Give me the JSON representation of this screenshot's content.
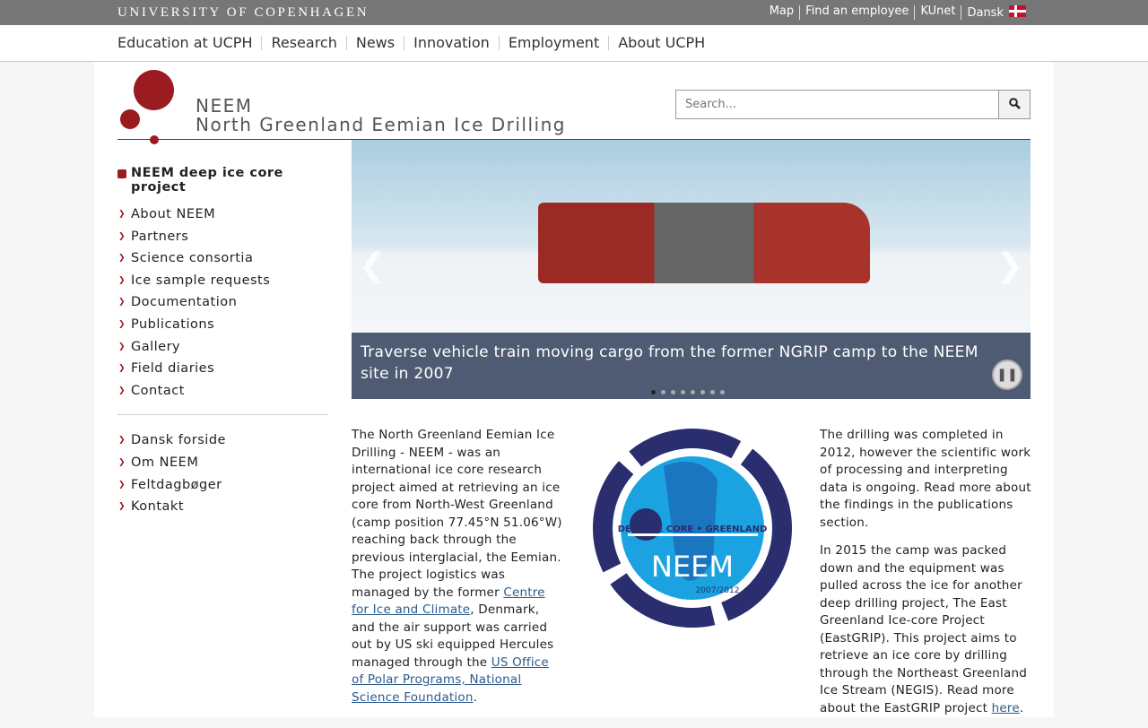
{
  "topbar": {
    "university": "UNIVERSITY OF COPENHAGEN",
    "links": [
      "Map",
      "Find an employee",
      "KUnet",
      "Dansk"
    ]
  },
  "nav": [
    "Education at UCPH",
    "Research",
    "News",
    "Innovation",
    "Employment",
    "About UCPH"
  ],
  "header": {
    "short": "NEEM",
    "title": "North Greenland Eemian Ice Drilling",
    "search_placeholder": "Search..."
  },
  "sidebar": {
    "heading": "NEEM deep ice core project",
    "items": [
      "About NEEM",
      "Partners",
      "Science consortia",
      "Ice sample requests",
      "Documentation",
      "Publications",
      "Gallery",
      "Field diaries",
      "Contact"
    ],
    "danish": [
      "Dansk forside",
      "Om NEEM",
      "Feltdagbøger",
      "Kontakt"
    ]
  },
  "slider": {
    "caption": "Traverse vehicle train moving cargo from the former NGRIP camp to the NEEM site in 2007",
    "slides": 8,
    "active": 1
  },
  "logo": {
    "text": "DEEP ICE CORE • GREENLAND",
    "name": "NEEM",
    "years": "2007/2012"
  },
  "col1": {
    "t1": "The North Greenland Eemian Ice Drilling - NEEM - was an international ice core research project aimed at retrieving an ice core from North-West Greenland (camp position 77.45°N 51.06°W) reaching back through the previous interglacial, the Eemian. The project logistics was managed by the former ",
    "l1": "Centre for Ice and Climate",
    "t2": ", Denmark, and the air support was carried out by US ski equipped Hercules managed through the ",
    "l2": "US Office of Polar Programs, National Science Foundation",
    "t3": "."
  },
  "col2": {
    "p1": "The drilling was completed in 2012, however the scientific work of processing and interpreting data is ongoing. Read more about the findings in the publications section.",
    "p2": "In 2015 the camp was packed down and the equipment was pulled across the ice for another deep drilling project, The East Greenland Ice-core Project (EastGRIP). This project aims to retrieve an ice core by drilling through the Northeast Greenland Ice Stream (NEGIS). Read more about the EastGRIP project ",
    "link": "here",
    "end": "."
  }
}
